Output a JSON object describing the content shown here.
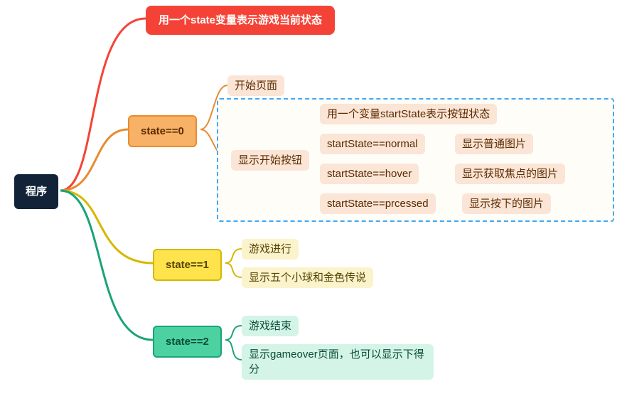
{
  "chart_data": {
    "type": "mindmap",
    "root": "程序",
    "branches": [
      {
        "color": "red",
        "label": "用一个state变量表示游戏当前状态",
        "children": []
      },
      {
        "color": "orange",
        "label": "state==0",
        "children": [
          {
            "label": "开始页面"
          },
          {
            "label": "显示开始按钮",
            "grouped": true,
            "children": [
              {
                "label": "用一个变量startState表示按钮状态"
              },
              {
                "label": "startState==normal",
                "children": [
                  {
                    "label": "显示普通图片"
                  }
                ]
              },
              {
                "label": "startState==hover",
                "children": [
                  {
                    "label": "显示获取焦点的图片"
                  }
                ]
              },
              {
                "label": "startState==prcessed",
                "children": [
                  {
                    "label": "显示按下的图片"
                  }
                ]
              }
            ]
          }
        ]
      },
      {
        "color": "yellow",
        "label": "state==1",
        "children": [
          {
            "label": "游戏进行"
          },
          {
            "label": "显示五个小球和金色传说"
          }
        ]
      },
      {
        "color": "green",
        "label": "state==2",
        "children": [
          {
            "label": "游戏结束"
          },
          {
            "label": "显示gameover页面，也可以显示下得分"
          }
        ]
      }
    ]
  },
  "nodes": {
    "root": "程序",
    "red": "用一个state变量表示游戏当前状态",
    "s0": "state==0",
    "s0a": "开始页面",
    "s0b": "显示开始按钮",
    "s0b1": "用一个变量startState表示按钮状态",
    "s0b2": "startState==normal",
    "s0b2r": "显示普通图片",
    "s0b3": "startState==hover",
    "s0b3r": "显示获取焦点的图片",
    "s0b4": "startState==prcessed",
    "s0b4r": "显示按下的图片",
    "s1": "state==1",
    "s1a": "游戏进行",
    "s1b": "显示五个小球和金色传说",
    "s2": "state==2",
    "s2a": "游戏结束",
    "s2b": "显示gameover页面，也可以显示下得分"
  },
  "colors": {
    "red": "#f44336",
    "orange": "#e88c30",
    "yellow": "#d6b800",
    "green": "#1aa37a",
    "dash": "#3fa9f5"
  }
}
